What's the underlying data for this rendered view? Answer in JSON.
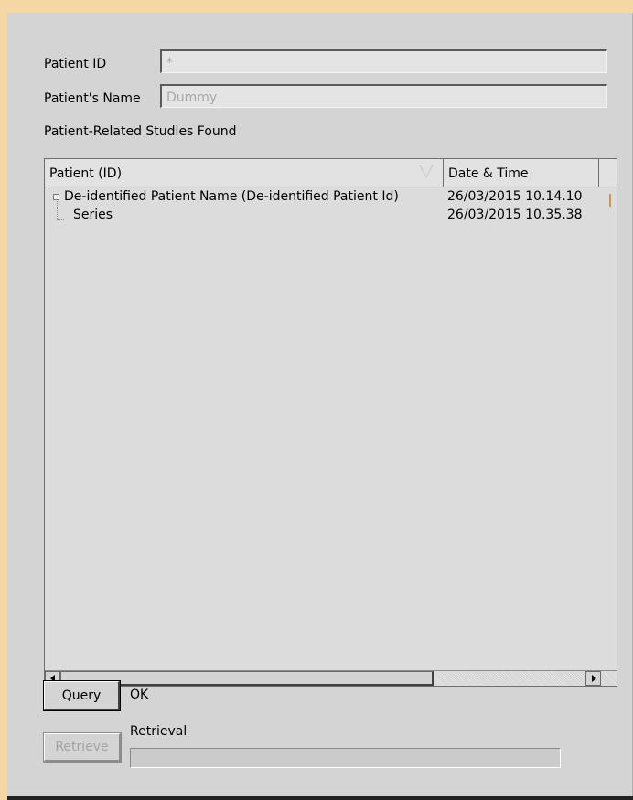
{
  "query_form": {
    "patient_id_label": "Patient ID",
    "patient_id_value": "*",
    "patient_name_label": "Patient's Name",
    "patient_name_value": "Dummy"
  },
  "studies": {
    "section_label": "Patient-Related Studies Found",
    "columns": [
      "Patient (ID)",
      "Date & Time",
      ""
    ],
    "rows": [
      {
        "label": "De-identified Patient Name (De-identified Patient Id)",
        "datetime": "26/03/2015 10.14.10",
        "expanded": true
      },
      {
        "label": "Series",
        "datetime": "26/03/2015 10.35.38"
      }
    ]
  },
  "actions": {
    "query_label": "Query",
    "query_status": "OK",
    "retrieve_label": "Retrieve",
    "retrieve_enabled": false,
    "retrieval_label": "Retrieval",
    "retrieval_progress": 0
  },
  "icons": {
    "sort": "sort-descending-icon",
    "expand": "tree-collapse-icon",
    "scroll_left": "arrow-left-icon",
    "scroll_right": "arrow-right-icon"
  },
  "colors": {
    "window_bg": "#f5d7a3",
    "panel_bg": "#d4d4d4",
    "tree_bg": "#dcdcdc",
    "header_bg": "#e2e2e2"
  }
}
